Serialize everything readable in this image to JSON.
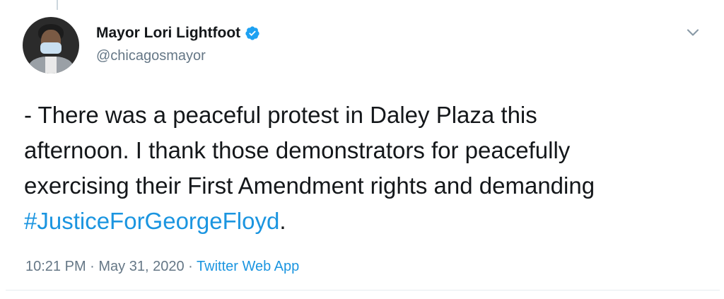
{
  "tweet": {
    "author": {
      "display_name": "Mayor Lori Lightfoot",
      "handle": "@chicagosmayor",
      "verified": true
    },
    "text": {
      "line1": "- There was a peaceful protest in Daley Plaza this",
      "line2": "afternoon. I thank those demonstrators for peacefully",
      "line3": "exercising their First Amendment rights and demanding",
      "hashtag": "#JusticeForGeorgeFloyd",
      "trailing": "."
    },
    "meta": {
      "time": "10:21 PM",
      "separator": " · ",
      "date": "May 31, 2020",
      "source": "Twitter Web App"
    },
    "icons": {
      "verified": "verified-badge-icon",
      "menu": "chevron-down-icon"
    },
    "colors": {
      "link": "#1b95e0",
      "secondary_text": "#657786",
      "primary_text": "#14171a"
    }
  }
}
